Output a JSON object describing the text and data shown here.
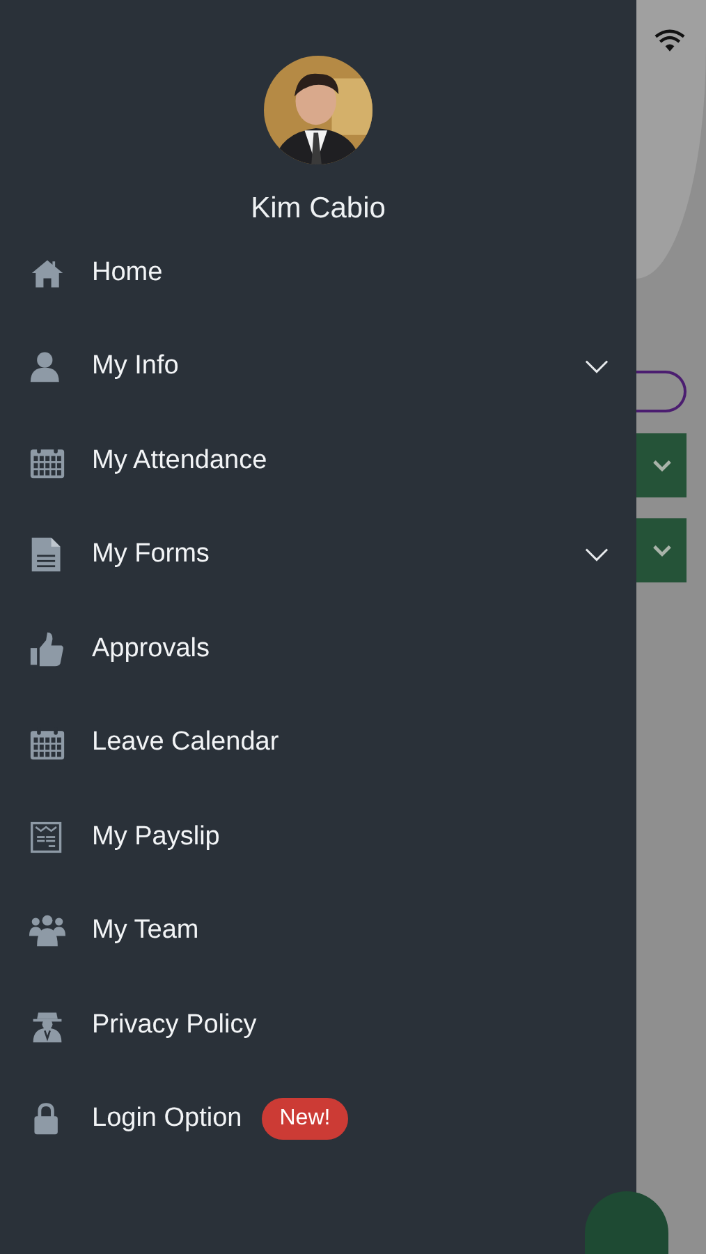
{
  "drawer": {
    "user_name": "Kim Cabio",
    "menu": [
      {
        "label": "Home",
        "expandable": false
      },
      {
        "label": "My Info",
        "expandable": true
      },
      {
        "label": "My Attendance",
        "expandable": false
      },
      {
        "label": "My Forms",
        "expandable": true
      },
      {
        "label": "Approvals",
        "expandable": false
      },
      {
        "label": "Leave Calendar",
        "expandable": false
      },
      {
        "label": "My Payslip",
        "expandable": false
      },
      {
        "label": "My Team",
        "expandable": false
      },
      {
        "label": "Privacy Policy",
        "expandable": false
      },
      {
        "label": "Login Option",
        "expandable": false,
        "badge": "New!"
      }
    ]
  }
}
